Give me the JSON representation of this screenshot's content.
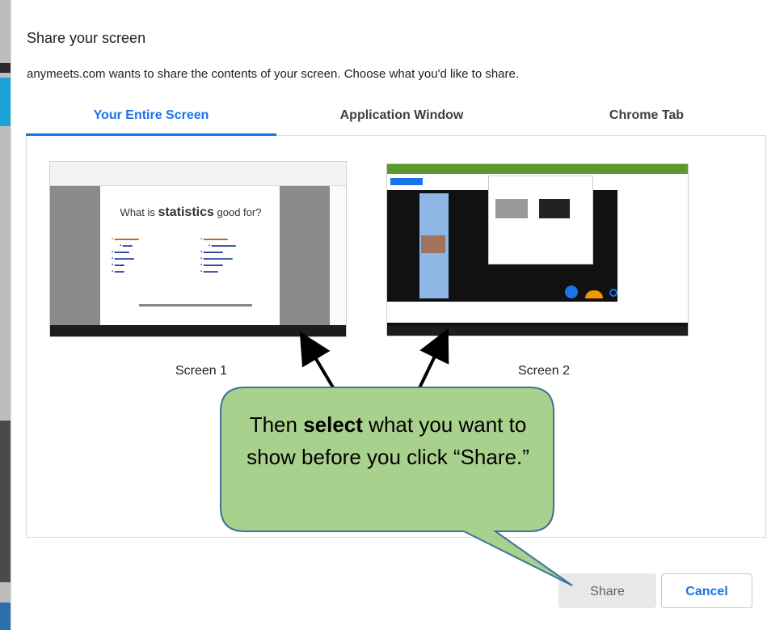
{
  "dialog": {
    "title": "Share your screen",
    "subtitle": "anymeets.com wants to share the contents of your screen. Choose what you'd like to share."
  },
  "tabs": [
    {
      "label": "Your Entire Screen",
      "active": true
    },
    {
      "label": "Application Window",
      "active": false
    },
    {
      "label": "Chrome Tab",
      "active": false
    }
  ],
  "screens": [
    {
      "label": "Screen 1",
      "preview_title_prefix": "What is",
      "preview_title_emph": "statistics",
      "preview_title_suffix": "good for?"
    },
    {
      "label": "Screen 2"
    }
  ],
  "buttons": {
    "share": "Share",
    "cancel": "Cancel"
  },
  "callout": {
    "before": "Then",
    "bold": "select",
    "after": "what you want to show before you click “Share.”",
    "fill": "#a9d18e",
    "stroke": "#41719c"
  },
  "colors": {
    "accent": "#1a73e8",
    "tab_border": "#dadce0"
  }
}
